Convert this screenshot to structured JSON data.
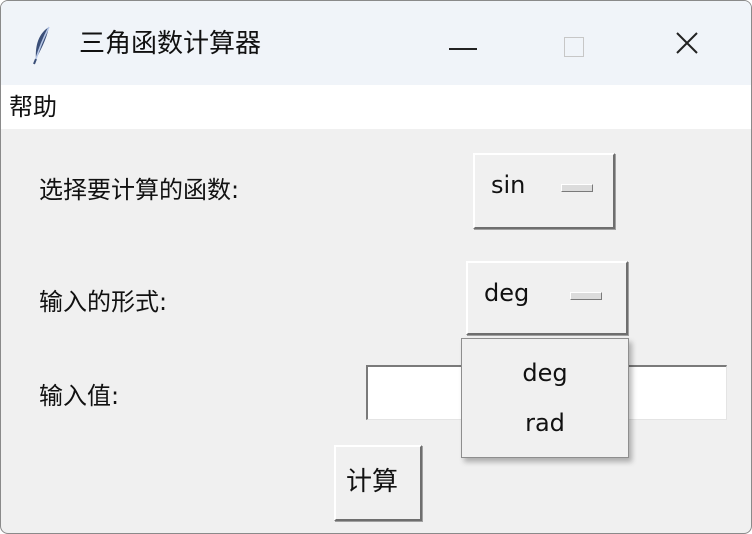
{
  "window": {
    "title": "三角函数计算器",
    "app_icon": "feather-icon",
    "controls": [
      "minimize-icon",
      "maximize-icon",
      "close-icon"
    ]
  },
  "menubar": {
    "items": [
      {
        "label": "帮助"
      }
    ]
  },
  "form": {
    "function_label": "选择要计算的函数:",
    "function_value": "sin",
    "format_label": "输入的形式:",
    "format_value": "deg",
    "input_label": "输入值:",
    "input_value": "",
    "calculate_label": "计算"
  },
  "dropdown": {
    "options": [
      "deg",
      "rad"
    ]
  }
}
